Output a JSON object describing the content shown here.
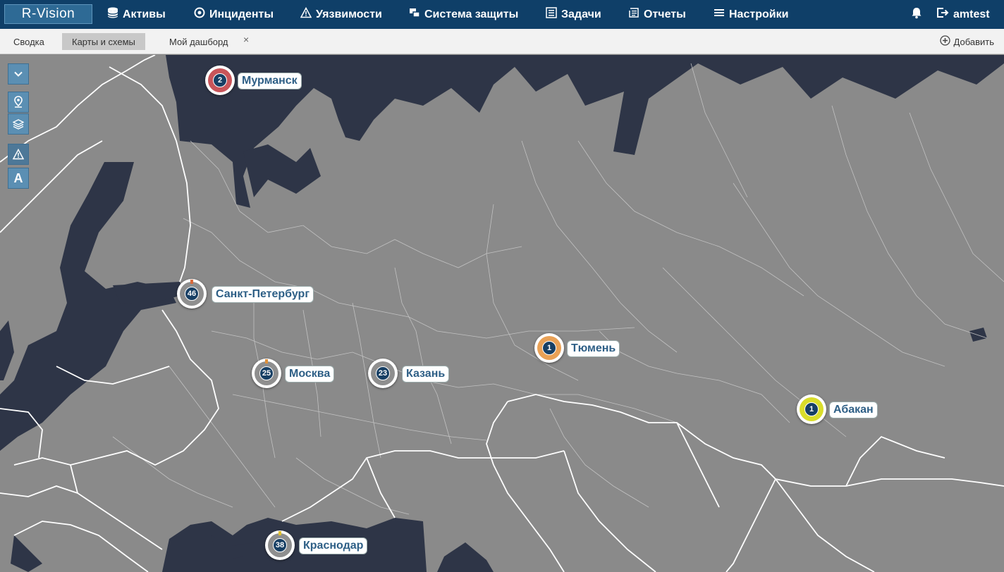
{
  "app": {
    "logo": "R-Vision",
    "user": "amtest"
  },
  "nav": [
    {
      "label": "Активы",
      "icon": "database-icon"
    },
    {
      "label": "Инциденты",
      "icon": "target-icon"
    },
    {
      "label": "Уязвимости",
      "icon": "warning-icon"
    },
    {
      "label": "Система защиты",
      "icon": "windows-icon"
    },
    {
      "label": "Задачи",
      "icon": "tasks-icon"
    },
    {
      "label": "Отчеты",
      "icon": "report-icon"
    },
    {
      "label": "Настройки",
      "icon": "menu-icon"
    }
  ],
  "tabs": [
    {
      "label": "Сводка"
    },
    {
      "label": "Карты и схемы"
    },
    {
      "label": "Мой дашборд"
    }
  ],
  "tab_close": "×",
  "add_button": "Добавить",
  "map_tools": [
    {
      "icon": "chevron-down-icon"
    },
    {
      "icon": "map-pin-icon"
    },
    {
      "icon": "layers-icon"
    },
    {
      "icon": "warning-icon"
    },
    {
      "icon": "text-label-icon",
      "glyph": "A"
    }
  ],
  "markers": [
    {
      "name": "murmansk",
      "count": "2",
      "city": "Мурманск",
      "ring": "#c8555a",
      "tick": "#c8555a"
    },
    {
      "name": "saint-petersburg",
      "count": "46",
      "city": "Санкт-Петербург",
      "ring": "#8f8f8f",
      "tick": "#d9693a"
    },
    {
      "name": "moscow",
      "count": "25",
      "city": "Москва",
      "ring": "#8f8f8f",
      "tick": "#e0913a"
    },
    {
      "name": "kazan",
      "count": "23",
      "city": "Казань",
      "ring": "#8f8f8f",
      "tick": ""
    },
    {
      "name": "tyumen",
      "count": "1",
      "city": "Тюмень",
      "ring": "#e9a156",
      "tick": ""
    },
    {
      "name": "abakan",
      "count": "1",
      "city": "Абакан",
      "ring": "#d9dd2a",
      "tick": ""
    },
    {
      "name": "krasnodar",
      "count": "38",
      "city": "Краснодар",
      "ring": "#8f8f8f",
      "tick": "#e0c030"
    }
  ],
  "colors": {
    "header": "#0f3f68",
    "water": "#2e3547",
    "land": "#8a8a8a",
    "border": "#ffffff"
  }
}
